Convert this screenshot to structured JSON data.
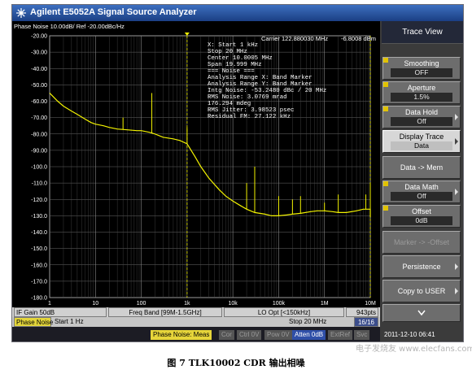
{
  "window": {
    "title": "Agilent E5052A Signal Source Analyzer"
  },
  "trace": {
    "header": "Phase Noise 10.00dB/ Ref -20.00dBc/Hz",
    "marker_readout": {
      "carrier": "Carrier 122.880030 MHz",
      "level": "-6.8008 dBm"
    }
  },
  "annotation": {
    "lines": [
      "X: Start 1 kHz",
      "    Stop 20 MHz",
      "  Center 10.0005 MHz",
      "    Span 19.999 MHz",
      "===  Noise  ===",
      "Analysis Range X: Band Marker",
      "Analysis Range Y: Band Marker",
      "Intg Noise: -53.2480 dBc / 20 MHz",
      "  RMS Noise: 3.0769 mrad",
      "             176.294 mdeg",
      "RMS Jitter: 3.98523 psec",
      "Residual FM: 27.122 kHz"
    ]
  },
  "chart_data": {
    "type": "line",
    "xscale": "log",
    "xlim": [
      1,
      10000000
    ],
    "ylim": [
      -180,
      -20
    ],
    "y_ticks": [
      "-20.00",
      "-30.00",
      "-40.00",
      "-50.00",
      "-60.00",
      "-70.00",
      "-80.00",
      "-90.00",
      "-100.0",
      "-110.0",
      "-120.0",
      "-130.0",
      "-140.0",
      "-150.0",
      "-160.0",
      "-170.0",
      "-180.0"
    ],
    "x_ticks": [
      {
        "x": 1,
        "label": "1"
      },
      {
        "x": 10,
        "label": "10"
      },
      {
        "x": 100,
        "label": "100"
      },
      {
        "x": 1000,
        "label": "1k"
      },
      {
        "x": 10000,
        "label": "10k"
      },
      {
        "x": 100000,
        "label": "100k"
      },
      {
        "x": 1000000,
        "label": "1M"
      },
      {
        "x": 10000000,
        "label": "10M"
      }
    ],
    "grid": true,
    "band_marker": [
      1000,
      20000000
    ],
    "series": [
      {
        "color": "#f3f300",
        "x": [
          1,
          1.5,
          2,
          3,
          4,
          6,
          8,
          10,
          15,
          20,
          30,
          50,
          80,
          100,
          150,
          200,
          300,
          500,
          700,
          1000,
          1500,
          2000,
          3000,
          5000,
          7000,
          10000,
          15000,
          20000,
          30000,
          50000,
          70000,
          100000,
          150000,
          200000,
          300000,
          500000,
          700000,
          1000000,
          1500000,
          2000000,
          3000000,
          5000000,
          7000000,
          10000000,
          15000000,
          20000000
        ],
        "y": [
          -55,
          -60,
          -63,
          -66,
          -68,
          -71,
          -73,
          -74,
          -75,
          -76,
          -77,
          -77.5,
          -78,
          -78,
          -79,
          -80,
          -82,
          -83,
          -84,
          -86,
          -94,
          -100,
          -107,
          -114,
          -118,
          -121,
          -124,
          -126,
          -128,
          -129,
          -130,
          -130,
          -129.5,
          -129,
          -128.5,
          -127.5,
          -127,
          -127,
          -127.5,
          -128,
          -128,
          -127,
          -126,
          -126,
          -129,
          -131
        ]
      }
    ],
    "spurs": [
      {
        "x": 170,
        "y": -55
      },
      {
        "x": 40,
        "y": -70
      },
      {
        "x": 1000,
        "y": -76
      },
      {
        "x": 20000,
        "y": -110
      },
      {
        "x": 30000,
        "y": -100
      },
      {
        "x": 100000,
        "y": -118
      },
      {
        "x": 200000,
        "y": -120
      },
      {
        "x": 300000,
        "y": -118
      },
      {
        "x": 1000000,
        "y": -122
      },
      {
        "x": 2000000,
        "y": -117
      },
      {
        "x": 8000000,
        "y": -117
      },
      {
        "x": 12000000,
        "y": -110
      }
    ]
  },
  "softkeys": {
    "title": "Trace View",
    "items": [
      {
        "label": "Smoothing",
        "value": "OFF"
      },
      {
        "label": "Aperture",
        "value": "1.5%"
      },
      {
        "label": "Data Hold",
        "value": "Off"
      },
      {
        "label": "Display Trace",
        "value": "Data"
      },
      {
        "label": "Data -> Mem",
        "value": ""
      },
      {
        "label": "Data Math",
        "value": "Off"
      },
      {
        "label": "Offset",
        "value": "0dB"
      },
      {
        "label": "Marker -> -Offset",
        "value": ""
      },
      {
        "label": "Persistence",
        "value": ""
      },
      {
        "label": "Copy to USER",
        "value": ""
      }
    ]
  },
  "status": {
    "if_gain": "IF Gain 50dB",
    "freq_band": "Freq Band [99M-1.5GHz]",
    "lo_opt": "LO Opt [<150kHz]",
    "points": "943pts",
    "meas_label": "Phase Noise",
    "start": "Start 1 Hz",
    "stop": "Stop 20 MHz",
    "count": "16/16",
    "chips": {
      "phase_noise_meas": "Phase Noise: Meas",
      "cor": "Cor",
      "ctrl": "Ctrl 0V",
      "pow": "Pow 0V",
      "atten": "Atten 0dB",
      "extref": "ExtRef",
      "svc": "Svc",
      "datetime": "2011-12-10 06:41"
    }
  },
  "caption": "图 7 TLK10002 CDR 输出相噪",
  "watermark": "电子发烧友 www.elecfans.com"
}
